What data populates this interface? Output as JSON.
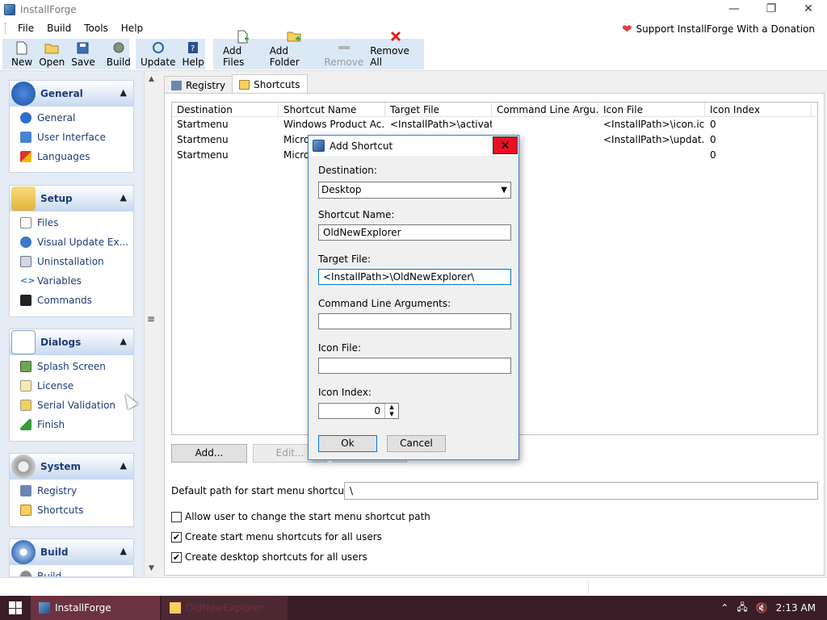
{
  "window": {
    "title": "InstallForge",
    "minimize_glyph": "—",
    "restore_glyph": "❐",
    "close_glyph": "✕"
  },
  "menu": {
    "items": [
      "File",
      "Build",
      "Tools",
      "Help"
    ],
    "donation": "Support InstallForge With a Donation"
  },
  "toolbar": {
    "new": "New",
    "open": "Open",
    "save": "Save",
    "build": "Build",
    "update": "Update",
    "help": "Help",
    "add_files": "Add Files",
    "add_folder": "Add Folder",
    "remove": "Remove",
    "remove_all": "Remove All"
  },
  "sidebar": {
    "general": {
      "title": "General",
      "items": [
        "General",
        "User Interface",
        "Languages"
      ]
    },
    "setup": {
      "title": "Setup",
      "items": [
        "Files",
        "Visual Update Ex...",
        "Uninstallation",
        "Variables",
        "Commands"
      ]
    },
    "dialogs": {
      "title": "Dialogs",
      "items": [
        "Splash Screen",
        "License",
        "Serial Validation",
        "Finish"
      ]
    },
    "system": {
      "title": "System",
      "items": [
        "Registry",
        "Shortcuts"
      ]
    },
    "build": {
      "title": "Build",
      "items": [
        "Build"
      ]
    }
  },
  "tabs": {
    "registry": "Registry",
    "shortcuts": "Shortcuts"
  },
  "table": {
    "columns": [
      "Destination",
      "Shortcut Name",
      "Target File",
      "Command Line Argu...",
      "Icon File",
      "Icon Index"
    ],
    "rows": [
      [
        "Startmenu",
        "Windows Product Ac...",
        "<InstallPath>\\activat...",
        "",
        "<InstallPath>\\icon.ico",
        "0"
      ],
      [
        "Startmenu",
        "Micro",
        "",
        "",
        "<InstallPath>\\updat...",
        "0"
      ],
      [
        "Startmenu",
        "Micro",
        "",
        "",
        "",
        "0"
      ]
    ]
  },
  "actions": {
    "add": "Add...",
    "edit": "Edit..."
  },
  "settings": {
    "default_path_label": "Default path for start menu shortcuts:",
    "default_path_value": "\\",
    "allow_change": "Allow user to change the start menu shortcut path",
    "startmenu_all_users": "Create start menu shortcuts for all users",
    "desktop_all_users": "Create desktop shortcuts for all users"
  },
  "dialog": {
    "title": "Add Shortcut",
    "destination_label": "Destination:",
    "destination_value": "Desktop",
    "shortcut_name_label": "Shortcut Name:",
    "shortcut_name_value": "OldNewExplorer",
    "target_file_label": "Target File:",
    "target_file_value": "<InstallPath>\\OldNewExplorer\\",
    "cmd_args_label": "Command Line Arguments:",
    "cmd_args_value": "",
    "icon_file_label": "Icon File:",
    "icon_file_value": "",
    "icon_index_label": "Icon Index:",
    "icon_index_value": "0",
    "ok": "Ok",
    "cancel": "Cancel"
  },
  "taskbar": {
    "items": [
      "InstallForge",
      "OldNewExplorer"
    ],
    "time": "2:13 AM"
  },
  "colors": {
    "accent": "#0078d7",
    "close_red": "#e81123",
    "taskbar": "#3a1d26",
    "toolbar_group": "#dbe8f6"
  }
}
